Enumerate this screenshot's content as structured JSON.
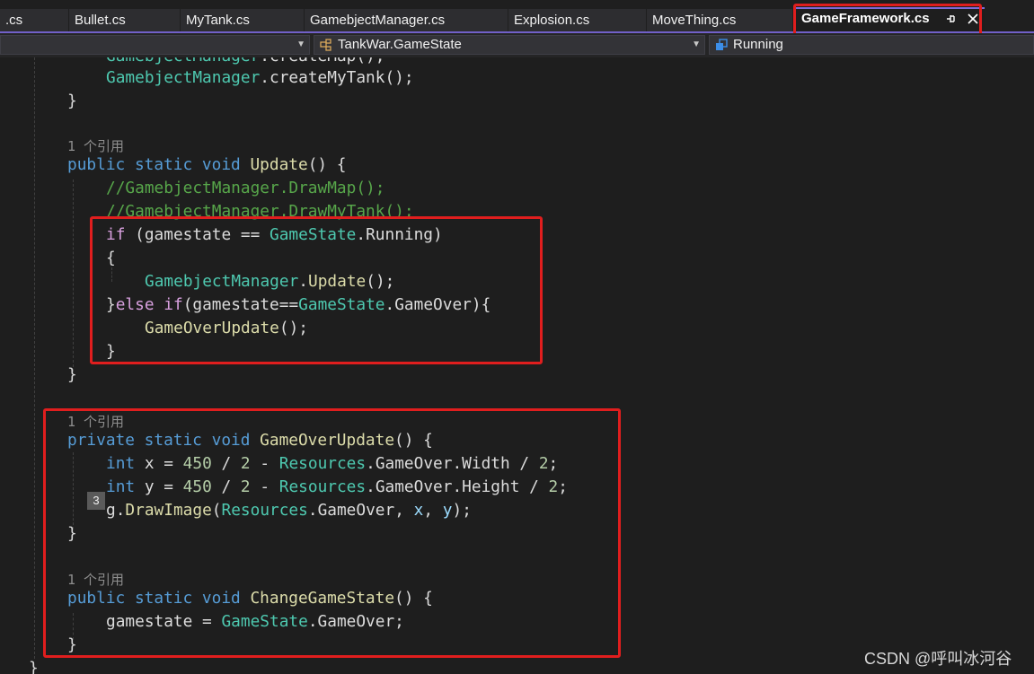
{
  "tabs": [
    {
      "label": ".cs",
      "active": false
    },
    {
      "label": "Bullet.cs",
      "active": false
    },
    {
      "label": "MyTank.cs",
      "active": false
    },
    {
      "label": "GamebjectManager.cs",
      "active": false
    },
    {
      "label": "Explosion.cs",
      "active": false
    },
    {
      "label": "MoveThing.cs",
      "active": false
    },
    {
      "label": "GameFramework.cs",
      "active": true,
      "pin_icon": "pin-icon",
      "close_icon": "close-icon"
    }
  ],
  "navbar": {
    "type_dropdown": {
      "value": "TankWar.GameState",
      "icon": "class-icon"
    },
    "member_dropdown": {
      "value": "Running",
      "icon": "enum-member-icon"
    }
  },
  "code": {
    "l0_a": "GamebjectManager",
    "l0_b": ".createMap();",
    "l1_a": "GamebjectManager",
    "l1_b": ".createMyTank();",
    "l2": "}",
    "lens_update": "1 个引用",
    "l4_kw1": "public",
    "l4_kw2": "static",
    "l4_kw3": "void",
    "l4_fn": "Update",
    "l4_rest": "() {",
    "l5": "//GamebjectManager.DrawMap();",
    "l6": "//GamebjectManager.DrawMyTank();",
    "l7_kw": "if",
    "l7_a": " (gamestate == ",
    "l7_ty": "GameState",
    "l7_b": ".Running)",
    "l8": "{",
    "l9_ty": "GamebjectManager",
    "l9_b": ".",
    "l9_fn": "Update",
    "l9_c": "();",
    "l10_a": "}",
    "l10_kw1": "else",
    "l10_kw2": "if",
    "l10_b": "(gamestate==",
    "l10_ty": "GameState",
    "l10_c": ".GameOver){",
    "l11_fn": "GameOverUpdate",
    "l11_b": "();",
    "l12": "}",
    "l13": "}",
    "lens_gameover": "1 个引用",
    "l15_kw1": "private",
    "l15_kw2": "static",
    "l15_kw3": "void",
    "l15_fn": "GameOverUpdate",
    "l15_rest": "() {",
    "l16_kw": "int",
    "l16_a": " x = ",
    "l16_n1": "450",
    "l16_b": " / ",
    "l16_n2": "2",
    "l16_c": " - ",
    "l16_ty": "Resources",
    "l16_d": ".GameOver.Width / ",
    "l16_n3": "2",
    "l16_e": ";",
    "l17_kw": "int",
    "l17_a": " y = ",
    "l17_n1": "450",
    "l17_b": " / ",
    "l17_n2": "2",
    "l17_c": " - ",
    "l17_ty": "Resources",
    "l17_d": ".GameOver.Height / ",
    "l17_n3": "2",
    "l17_e": ";",
    "l18_a": "g.",
    "l18_fn": "DrawImage",
    "l18_b": "(",
    "l18_ty": "Resources",
    "l18_c": ".GameOver, ",
    "l18_x": "x",
    "l18_d": ", ",
    "l18_y": "y",
    "l18_e": ");",
    "l19": "}",
    "badge": "3",
    "lens_change": "1 个引用",
    "l21_kw1": "public",
    "l21_kw2": "static",
    "l21_kw3": "void",
    "l21_fn": "ChangeGameState",
    "l21_rest": "() {",
    "l22_a": "gamestate = ",
    "l22_ty": "GameState",
    "l22_b": ".GameOver;",
    "l23": "}",
    "l24": "}"
  },
  "watermark": "CSDN @呼叫冰河谷",
  "colors": {
    "keyword": "#569cd6",
    "control_keyword": "#d8a0df",
    "type": "#4ec9b0",
    "method": "#dcdcaa",
    "comment": "#57a64a",
    "number": "#b5cea8",
    "highlight_box": "#e01e1e",
    "tab_accent": "#7160c8"
  }
}
